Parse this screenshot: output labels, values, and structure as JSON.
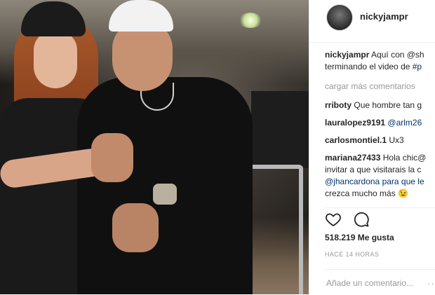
{
  "post": {
    "username": "nickyjampr",
    "caption": {
      "user": "nickyjampr",
      "line1": "Aquí con @sh",
      "line2_prefix": "terminando el video de #",
      "line2_link": "p"
    },
    "load_more": "cargar más comentarios",
    "comments": [
      {
        "user": "rriboty",
        "text": "Que hombre tan g"
      },
      {
        "user": "lauralopez9191",
        "text": "@arlm26"
      },
      {
        "user": "carlosmontiel.1",
        "text": "Ux3"
      },
      {
        "user": "mariana27433",
        "text": "Hola chic@",
        "cont": [
          "invitar a que visitarais la c",
          "@jhancardona para que le",
          "crezca mucho más 😉"
        ]
      }
    ],
    "likes": "518.219 Me gusta",
    "time": "HACE 14 HORAS",
    "add_comment_placeholder": "Añade un comentario...",
    "more_icon": "···"
  },
  "icons": [
    "heart-icon",
    "comment-icon"
  ],
  "colors": {
    "link": "#003569",
    "muted": "#999999",
    "text": "#262626"
  }
}
